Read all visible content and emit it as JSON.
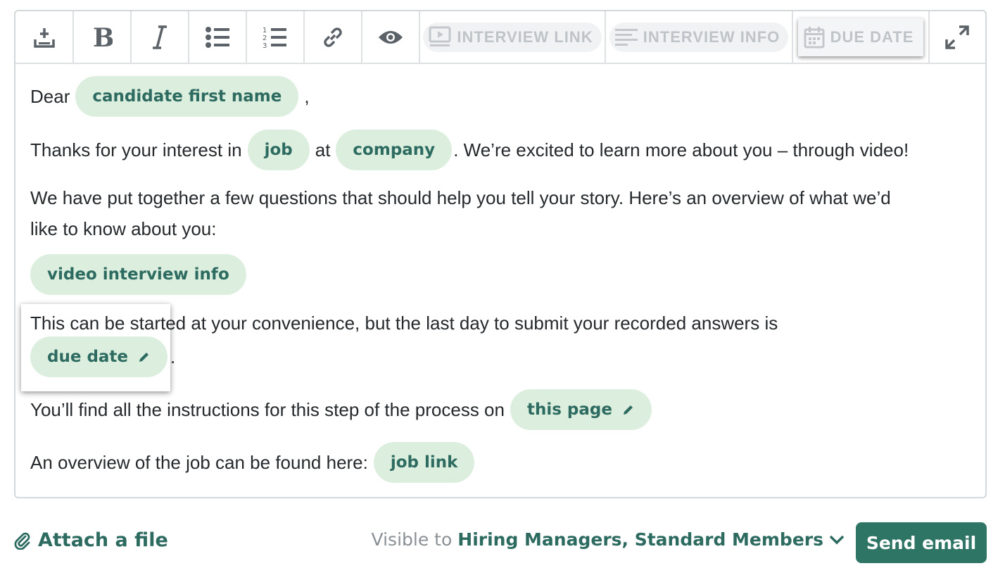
{
  "toolbar": {
    "buttons": [
      {
        "name": "insert-template-icon"
      },
      {
        "name": "bold-icon"
      },
      {
        "name": "italic-icon"
      },
      {
        "name": "bullet-list-icon"
      },
      {
        "name": "numbered-list-icon"
      },
      {
        "name": "link-icon"
      },
      {
        "name": "preview-eye-icon"
      }
    ],
    "tags": {
      "interview_link": "INTERVIEW LINK",
      "interview_info": "INTERVIEW INFO",
      "due_date": "DUE DATE"
    }
  },
  "body": {
    "line1": {
      "before": "Dear",
      "pill": "candidate first name",
      "after": ","
    },
    "line2": {
      "before": "Thanks for your interest in",
      "pill_job": "job",
      "mid": "at",
      "pill_company": "company",
      "after": ". We’re excited to learn more about you – through video!"
    },
    "line3a": "We have put together a few questions that should help you tell your story. Here’s an overview of what we’d",
    "line3b": "like to know about you:",
    "pill_video_info": "video interview info",
    "line4": "This can be started at your convenience, but the last day to submit your recorded answers is",
    "pill_due_date": "due date",
    "line4_end": ".",
    "line5": {
      "before": "You’ll find all the instructions for this step of the process on",
      "pill": "this page"
    },
    "line6": {
      "before": "An overview of the job can be found here:",
      "pill": "job link"
    }
  },
  "footer": {
    "attach_label": "Attach a file",
    "visible_prefix": "Visible to",
    "visible_to": "Hiring Managers, Standard Members",
    "send_label": "Send email"
  },
  "colors": {
    "accent": "#2d6b61",
    "pill_bg": "#dcefdf",
    "send_bg": "#2f7566"
  }
}
